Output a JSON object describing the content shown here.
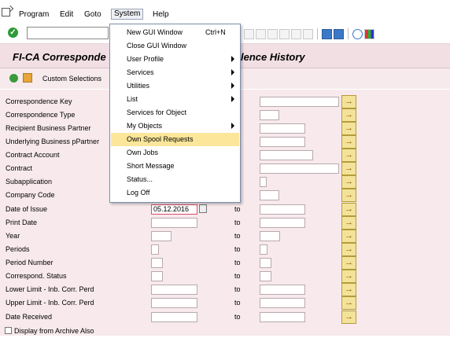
{
  "menubar": {
    "items": [
      "Program",
      "Edit",
      "Goto",
      "System",
      "Help"
    ]
  },
  "title": {
    "left": "FI-CA Corresponde",
    "right": "lence History"
  },
  "apptoolbar": {
    "custom_selections": "Custom Selections"
  },
  "system_menu": {
    "items": [
      {
        "label": "New GUI Window",
        "shortcut": "Ctrl+N",
        "submenu": false
      },
      {
        "label": "Close GUI Window",
        "shortcut": "",
        "submenu": false
      },
      {
        "label": "User Profile",
        "shortcut": "",
        "submenu": true
      },
      {
        "label": "Services",
        "shortcut": "",
        "submenu": true
      },
      {
        "label": "Utilities",
        "shortcut": "",
        "submenu": true
      },
      {
        "label": "List",
        "shortcut": "",
        "submenu": true
      },
      {
        "label": "Services for Object",
        "shortcut": "",
        "submenu": false
      },
      {
        "label": "My Objects",
        "shortcut": "",
        "submenu": true
      },
      {
        "label": "Own Spool Requests",
        "shortcut": "",
        "submenu": false,
        "highlighted": true
      },
      {
        "label": "Own Jobs",
        "shortcut": "",
        "submenu": false
      },
      {
        "label": "Short Message",
        "shortcut": "",
        "submenu": false
      },
      {
        "label": "Status...",
        "shortcut": "",
        "submenu": false
      },
      {
        "label": "Log Off",
        "shortcut": "",
        "submenu": false
      }
    ]
  },
  "form": {
    "to_label": "to",
    "fields": [
      {
        "label": "Correspondence Key"
      },
      {
        "label": "Correspondence Type"
      },
      {
        "label": "Recipient Business Partner"
      },
      {
        "label": "Underlying Business pPartner"
      },
      {
        "label": "Contract Account"
      },
      {
        "label": "Contract"
      },
      {
        "label": "Subapplication"
      },
      {
        "label": "Company Code"
      },
      {
        "label": "Date of Issue",
        "value": "05.12.2016"
      },
      {
        "label": "Print Date"
      },
      {
        "label": "Year"
      },
      {
        "label": "Periods"
      },
      {
        "label": "Period Number"
      },
      {
        "label": "Correspond. Status"
      },
      {
        "label": "Lower Limit - Inb. Corr. Perd"
      },
      {
        "label": "Upper Limit - Inb. Corr. Perd"
      },
      {
        "label": "Date Received"
      }
    ],
    "display_archive": "Display from Archive Also"
  }
}
